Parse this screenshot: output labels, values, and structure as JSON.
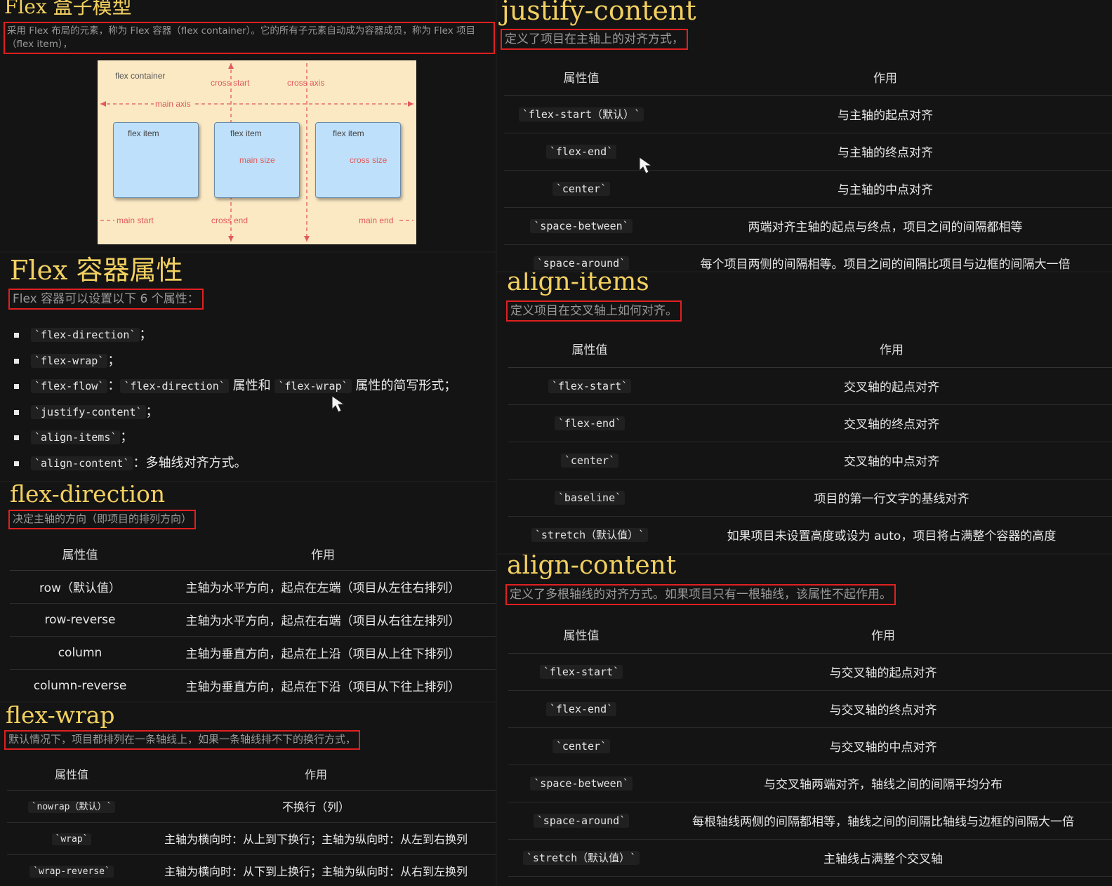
{
  "flex_box_model": {
    "title": "Flex 盒子模型",
    "desc_line1": "采用 Flex 布局的元素，称为 Flex 容器（flex container）。它的所有子元素自动成为容器成员，称为 Flex 项目",
    "desc_line2": "（flex item），",
    "diagram": {
      "container_label": "flex container",
      "cross_start": "cross start",
      "cross_axis": "cross axis",
      "main_axis": "main axis",
      "item1": "flex item",
      "item2": "flex item",
      "item3": "flex item",
      "main_size": "main size",
      "cross_size": "cross size",
      "main_start": "main start",
      "cross_end": "cross end",
      "main_end": "main end"
    }
  },
  "container_props": {
    "title": "Flex 容器属性",
    "desc": "Flex 容器可以设置以下 6 个属性：",
    "items": [
      {
        "code": "`flex-direction`",
        "rest": "；"
      },
      {
        "code": "`flex-wrap`",
        "rest": "；"
      },
      {
        "code": "`flex-flow`",
        "sep": "：",
        "code2": "`flex-direction`",
        "mid": " 属性和 ",
        "code3": "`flex-wrap`",
        "rest": " 属性的简写形式；"
      },
      {
        "code": "`justify-content`",
        "rest": "；"
      },
      {
        "code": "`align-items`",
        "rest": "；"
      },
      {
        "code": "`align-content`",
        "rest": "：多轴线对齐方式。"
      }
    ]
  },
  "flex_direction": {
    "title": "flex-direction",
    "desc": "决定主轴的方向（即项目的排列方向）",
    "col1": "属性值",
    "col2": "作用",
    "rows": [
      {
        "v": "row（默认值）",
        "d": "主轴为水平方向，起点在左端（项目从左往右排列）"
      },
      {
        "v": "row-reverse",
        "d": "主轴为水平方向，起点在右端（项目从右往左排列）"
      },
      {
        "v": "column",
        "d": "主轴为垂直方向，起点在上沿（项目从上往下排列）"
      },
      {
        "v": "column-reverse",
        "d": "主轴为垂直方向，起点在下沿（项目从下往上排列）"
      }
    ]
  },
  "flex_wrap": {
    "title": "flex-wrap",
    "desc": "默认情况下，项目都排列在一条轴线上，如果一条轴线排不下的换行方式，",
    "col1": "属性值",
    "col2": "作用",
    "rows": [
      {
        "v": "`nowrap（默认）`",
        "d": "不换行（列）"
      },
      {
        "v": "`wrap`",
        "d": "主轴为横向时：从上到下换行；主轴为纵向时：从左到右换列"
      },
      {
        "v": "`wrap-reverse`",
        "d": "主轴为横向时：从下到上换行；主轴为纵向时：从右到左换列"
      }
    ]
  },
  "justify_content": {
    "title": "justify-content",
    "desc": "定义了项目在主轴上的对齐方式，",
    "col1": "属性值",
    "col2": "作用",
    "rows": [
      {
        "v": "`flex-start（默认）`",
        "d": "与主轴的起点对齐"
      },
      {
        "v": "`flex-end`",
        "d": "与主轴的终点对齐"
      },
      {
        "v": "`center`",
        "d": "与主轴的中点对齐"
      },
      {
        "v": "`space-between`",
        "d": "两端对齐主轴的起点与终点，项目之间的间隔都相等"
      },
      {
        "v": "`space-around`",
        "d": "每个项目两侧的间隔相等。项目之间的间隔比项目与边框的间隔大一倍"
      }
    ]
  },
  "align_items": {
    "title": "align-items",
    "desc": "定义项目在交叉轴上如何对齐。",
    "col1": "属性值",
    "col2": "作用",
    "rows": [
      {
        "v": "`flex-start`",
        "d": "交叉轴的起点对齐"
      },
      {
        "v": "`flex-end`",
        "d": "交叉轴的终点对齐"
      },
      {
        "v": "`center`",
        "d": "交叉轴的中点对齐"
      },
      {
        "v": "`baseline`",
        "d": "项目的第一行文字的基线对齐"
      },
      {
        "v": "`stretch（默认值）`",
        "d": "如果项目未设置高度或设为 auto，项目将占满整个容器的高度"
      }
    ]
  },
  "align_content": {
    "title": "align-content",
    "desc": "定义了多根轴线的对齐方式。如果项目只有一根轴线，该属性不起作用。",
    "col1": "属性值",
    "col2": "作用",
    "rows": [
      {
        "v": "`flex-start`",
        "d": "与交叉轴的起点对齐"
      },
      {
        "v": "`flex-end`",
        "d": "与交叉轴的终点对齐"
      },
      {
        "v": "`center`",
        "d": "与交叉轴的中点对齐"
      },
      {
        "v": "`space-between`",
        "d": "与交叉轴两端对齐，轴线之间的间隔平均分布"
      },
      {
        "v": "`space-around`",
        "d": "每根轴线两侧的间隔都相等，轴线之间的间隔比轴线与边框的间隔大一倍"
      },
      {
        "v": "`stretch（默认值）`",
        "d": "主轴线占满整个交叉轴"
      }
    ]
  },
  "colors": {
    "title": "#f2d060",
    "highlight_border": "#e02020",
    "diagram_bg": "#fbe9c4",
    "item_bg": "#bfe0fa",
    "axis": "#e05a5a"
  }
}
